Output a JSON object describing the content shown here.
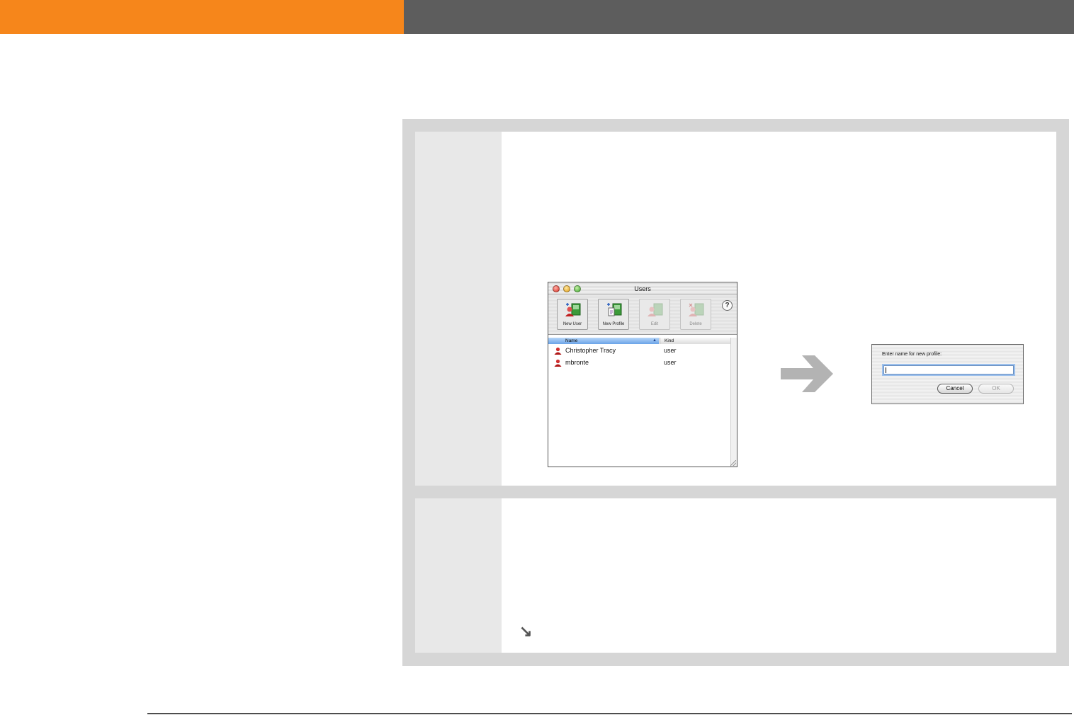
{
  "page": {
    "accent_color": "#f6861b",
    "bar_color": "#5d5d5d"
  },
  "users_window": {
    "title": "Users",
    "toolbar": [
      {
        "label": "New User",
        "icon": "new-user-icon",
        "enabled": true
      },
      {
        "label": "New Profile",
        "icon": "new-profile-icon",
        "enabled": true
      },
      {
        "label": "Edit",
        "icon": "edit-icon",
        "enabled": false
      },
      {
        "label": "Delete",
        "icon": "delete-icon",
        "enabled": false
      }
    ],
    "help_label": "?",
    "columns": {
      "name": "Name",
      "kind": "Kind",
      "sort_indicator": "▲"
    },
    "rows": [
      {
        "name": "Christopher Tracy",
        "kind": "user"
      },
      {
        "name": "mbronte",
        "kind": "user"
      }
    ]
  },
  "dialog": {
    "prompt": "Enter name for new profile:",
    "input_value": "",
    "cancel_label": "Cancel",
    "ok_label": "OK"
  },
  "continue_icon": "↘"
}
